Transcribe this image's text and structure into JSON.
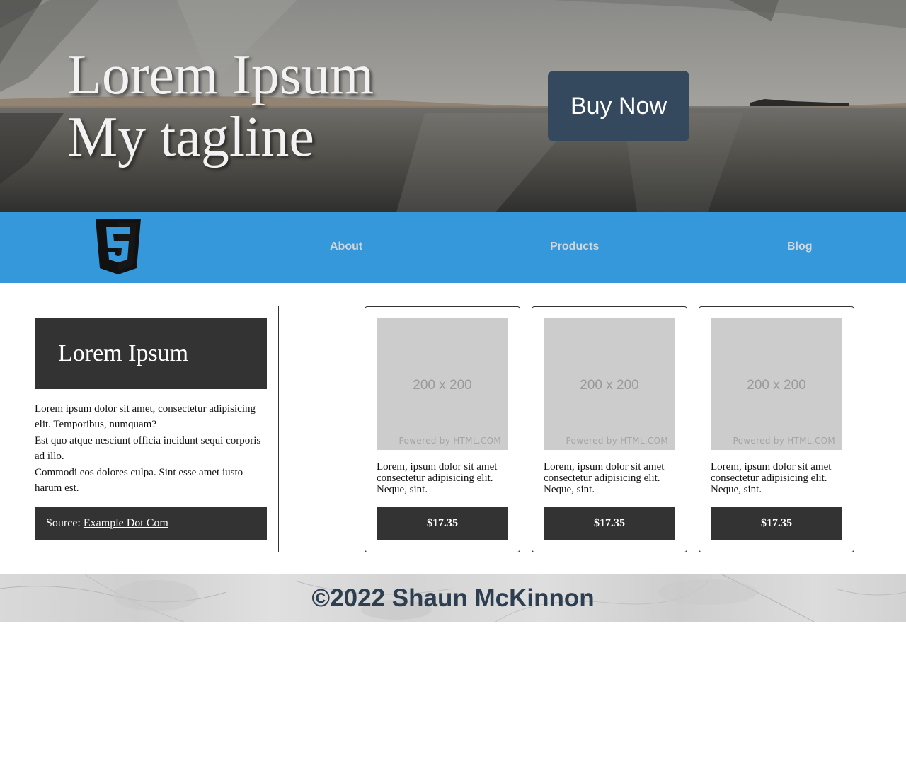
{
  "hero": {
    "title_line1": "Lorem Ipsum",
    "title_line2": "My tagline",
    "buy_button": "Buy Now"
  },
  "nav": {
    "logo_icon": "html5-logo-icon",
    "items": [
      {
        "label": "About"
      },
      {
        "label": "Products"
      },
      {
        "label": "Blog"
      }
    ]
  },
  "info_card": {
    "heading": "Lorem Ipsum",
    "paragraphs": [
      "Lorem ipsum dolor sit amet, consectetur adipisicing elit. Temporibus, numquam?",
      "Est quo atque nesciunt officia incidunt sequi corporis ad illo.",
      "Commodi eos dolores culpa. Sint esse amet iusto harum est."
    ],
    "source_label": "Source:",
    "source_link": "Example Dot Com"
  },
  "products": [
    {
      "image_size": "200 x 200",
      "image_powered": "Powered by HTML.COM",
      "description": "Lorem, ipsum dolor sit amet consectetur adipisicing elit. Neque, sint.",
      "price": "$17.35"
    },
    {
      "image_size": "200 x 200",
      "image_powered": "Powered by HTML.COM",
      "description": "Lorem, ipsum dolor sit amet consectetur adipisicing elit. Neque, sint.",
      "price": "$17.35"
    },
    {
      "image_size": "200 x 200",
      "image_powered": "Powered by HTML.COM",
      "description": "Lorem, ipsum dolor sit amet consectetur adipisicing elit. Neque, sint.",
      "price": "$17.35"
    }
  ],
  "footer": {
    "text": "©2022 Shaun McKinnon"
  },
  "colors": {
    "nav_bg": "#3498db",
    "buy_button_bg": "#34495e",
    "card_dark": "#333333",
    "footer_text": "#2c3e50"
  }
}
